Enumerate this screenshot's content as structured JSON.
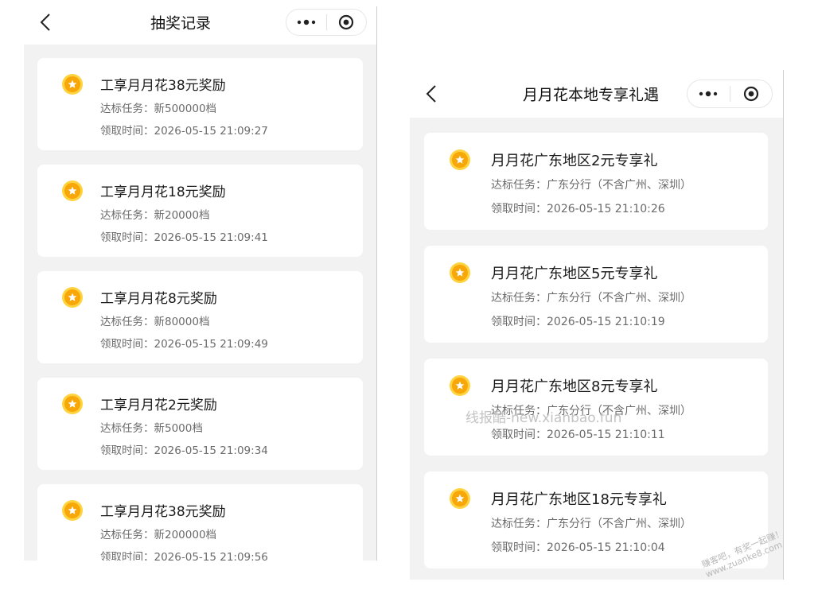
{
  "left": {
    "title": "抽奖记录",
    "records": [
      {
        "title": "工享月月花38元奖励",
        "task": "达标任务：新500000档",
        "time": "领取时间：2026-05-15 21:09:27"
      },
      {
        "title": "工享月月花18元奖励",
        "task": "达标任务：新20000档",
        "time": "领取时间：2026-05-15 21:09:41"
      },
      {
        "title": "工享月月花8元奖励",
        "task": "达标任务：新80000档",
        "time": "领取时间：2026-05-15 21:09:49"
      },
      {
        "title": "工享月月花2元奖励",
        "task": "达标任务：新5000档",
        "time": "领取时间：2026-05-15 21:09:34"
      },
      {
        "title": "工享月月花38元奖励",
        "task": "达标任务：新200000档",
        "time": "领取时间：2026-05-15 21:09:56"
      }
    ]
  },
  "right": {
    "title": "月月花本地专享礼遇",
    "records": [
      {
        "title": "月月花广东地区2元专享礼",
        "task": "达标任务：广东分行（不含广州、深圳）",
        "time": "领取时间：2026-05-15 21:10:26"
      },
      {
        "title": "月月花广东地区5元专享礼",
        "task": "达标任务：广东分行（不含广州、深圳）",
        "time": "领取时间：2026-05-15 21:10:19"
      },
      {
        "title": "月月花广东地区8元专享礼",
        "task": "达标任务：广东分行（不含广州、深圳）",
        "time": "领取时间：2026-05-15 21:10:11"
      },
      {
        "title": "月月花广东地区18元专享礼",
        "task": "达标任务：广东分行（不含广州、深圳）",
        "time": "领取时间：2026-05-15 21:10:04"
      }
    ]
  },
  "watermark": "线报酷-new.xianbao.fun",
  "corner_watermark": [
    "赚客吧，有奖一起赚！",
    "www.zuanke8.com"
  ],
  "icons": {
    "back": "chevron-left-icon",
    "more": "more-dots-icon",
    "close": "target-circle-icon",
    "coin": "gold-coin-star-icon"
  },
  "colors": {
    "coin_outer": "#ffd23f",
    "coin_inner": "#f7a707",
    "page_bg": "#f2f2f2"
  }
}
